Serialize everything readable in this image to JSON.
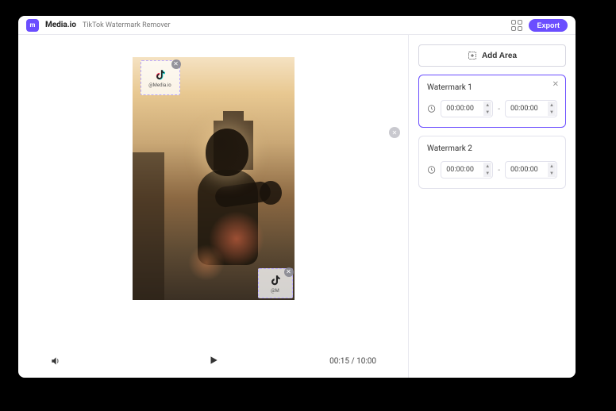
{
  "header": {
    "brand": "Media.io",
    "subtitle": "TikTok Watermark Remover",
    "export_label": "Export"
  },
  "preview": {
    "watermark_handle_1": "@Media.io",
    "watermark_handle_2": "@M",
    "timecode": "00:15 / 10:00"
  },
  "sidebar": {
    "add_area_label": "Add Area",
    "cards": [
      {
        "title": "Watermark 1",
        "start": "00:00:00",
        "end": "00:00:00",
        "active": true,
        "closable": true
      },
      {
        "title": "Watermark 2",
        "start": "00:00:00",
        "end": "00:00:00",
        "active": false,
        "closable": false
      }
    ],
    "dash": "-"
  }
}
